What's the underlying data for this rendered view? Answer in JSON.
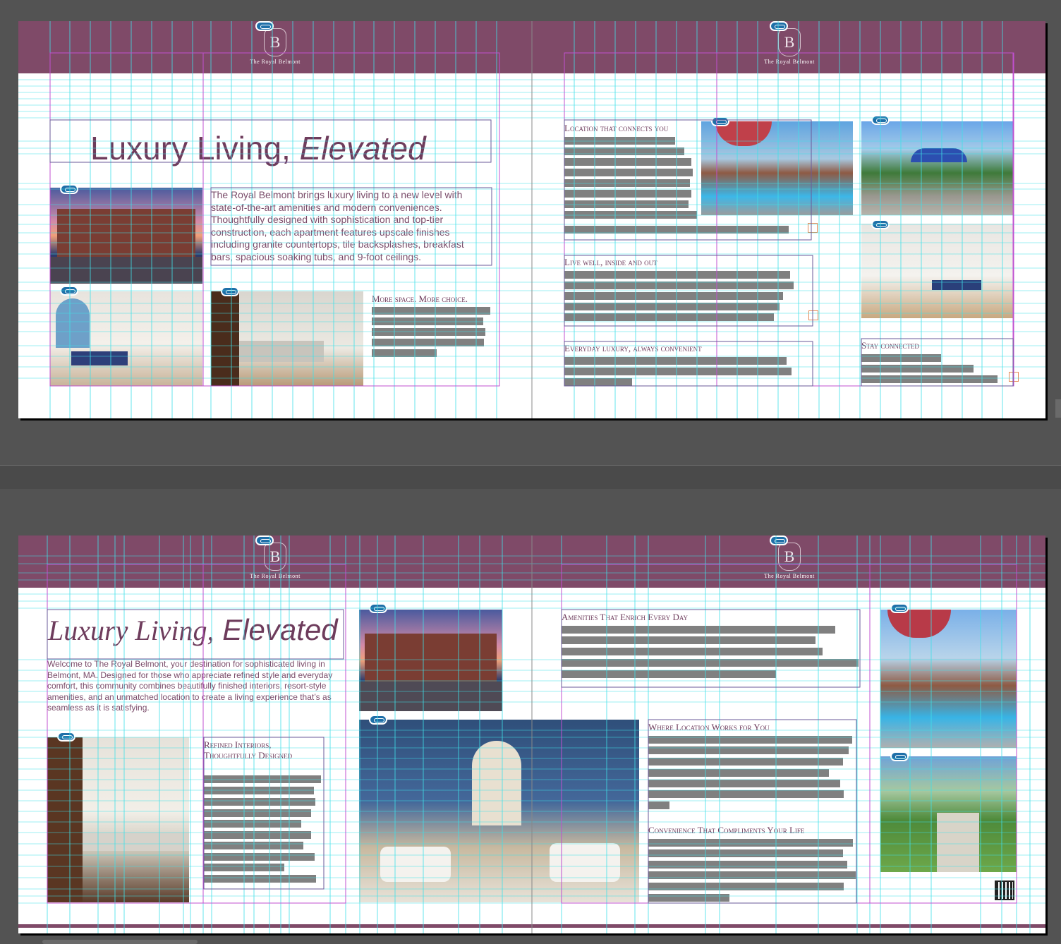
{
  "app": {
    "window": "Page layout editor"
  },
  "logo": {
    "monogram": "B",
    "name": "The Royal Belmont"
  },
  "spread1": {
    "title_plain": "Luxury Living, ",
    "title_italic": "Elevated",
    "intro": "The Royal Belmont brings luxury living to a new level with state-of-the-art amenities and modern conveniences. Thoughtfully designed with sophistication and top-tier construction, each apartment features upscale finishes including granite countertops, tile backsplashes, breakfast bars, spacious soaking tubs, and 9-foot ceilings.",
    "heading_space": "More space. More choice.",
    "heading_location": "Location that connects you",
    "heading_live": "Live well, inside and out",
    "heading_everyday": "Everyday luxury, always convenient",
    "heading_stay": "Stay connected"
  },
  "spread2": {
    "title_script": "Luxury Living,",
    "title_plain": " Elevated",
    "intro": "Welcome to The Royal Belmont, your destination for sophisticated living in Belmont, MA. Designed for those who appreciate refined style and everyday comfort, this community combines beautifully finished interiors, resort-style amenities, and an unmatched location to create a living experience that’s as seamless as it is satisfying.",
    "heading_refined_1": "Refined Interiors,",
    "heading_refined_2": "Thoughtfully Designed",
    "heading_amenities": "Amenities That Enrich Every Day",
    "heading_location": "Where Location Works for You",
    "heading_convenience": "Convenience That Compliments Your Life"
  },
  "colors": {
    "band": "#7f4a68",
    "heading": "#6e3c5c",
    "guide_cyan": "#3fe0e8",
    "guide_magenta": "#c050d0",
    "placeholder_bar": "#808080"
  },
  "icons": [
    "link-icon",
    "crest-icon",
    "qr-code-icon",
    "overset-text-icon"
  ]
}
